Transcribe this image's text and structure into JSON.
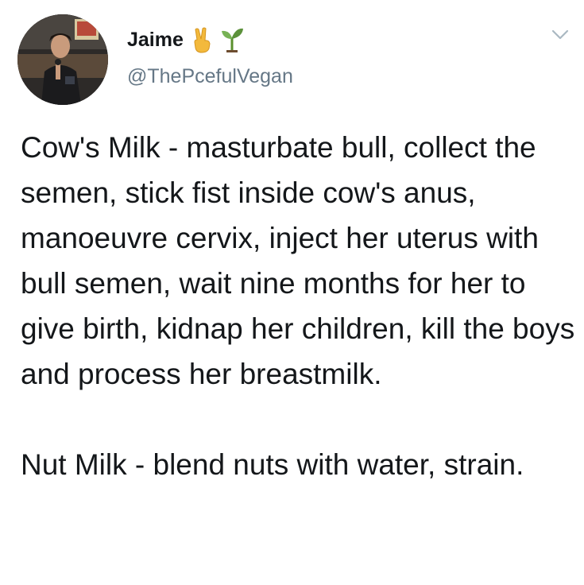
{
  "author": {
    "display_name": "Jaime",
    "handle": "@ThePcefulVegan",
    "name_emojis": [
      "victory-hand-emoji",
      "seedling-emoji"
    ]
  },
  "menu": {
    "icon": "chevron-down-icon"
  },
  "tweet": {
    "paragraphs": [
      "Cow's Milk - masturbate bull, collect the semen, stick fist inside cow's anus, manoeuvre cervix, inject her uterus with bull semen, wait nine months for her to give birth, kidnap her children, kill the boys and process her breastmilk.",
      "Nut Milk - blend nuts with water, strain."
    ]
  },
  "colors": {
    "text": "#14171a",
    "secondary_text": "#657786",
    "background": "#ffffff"
  }
}
